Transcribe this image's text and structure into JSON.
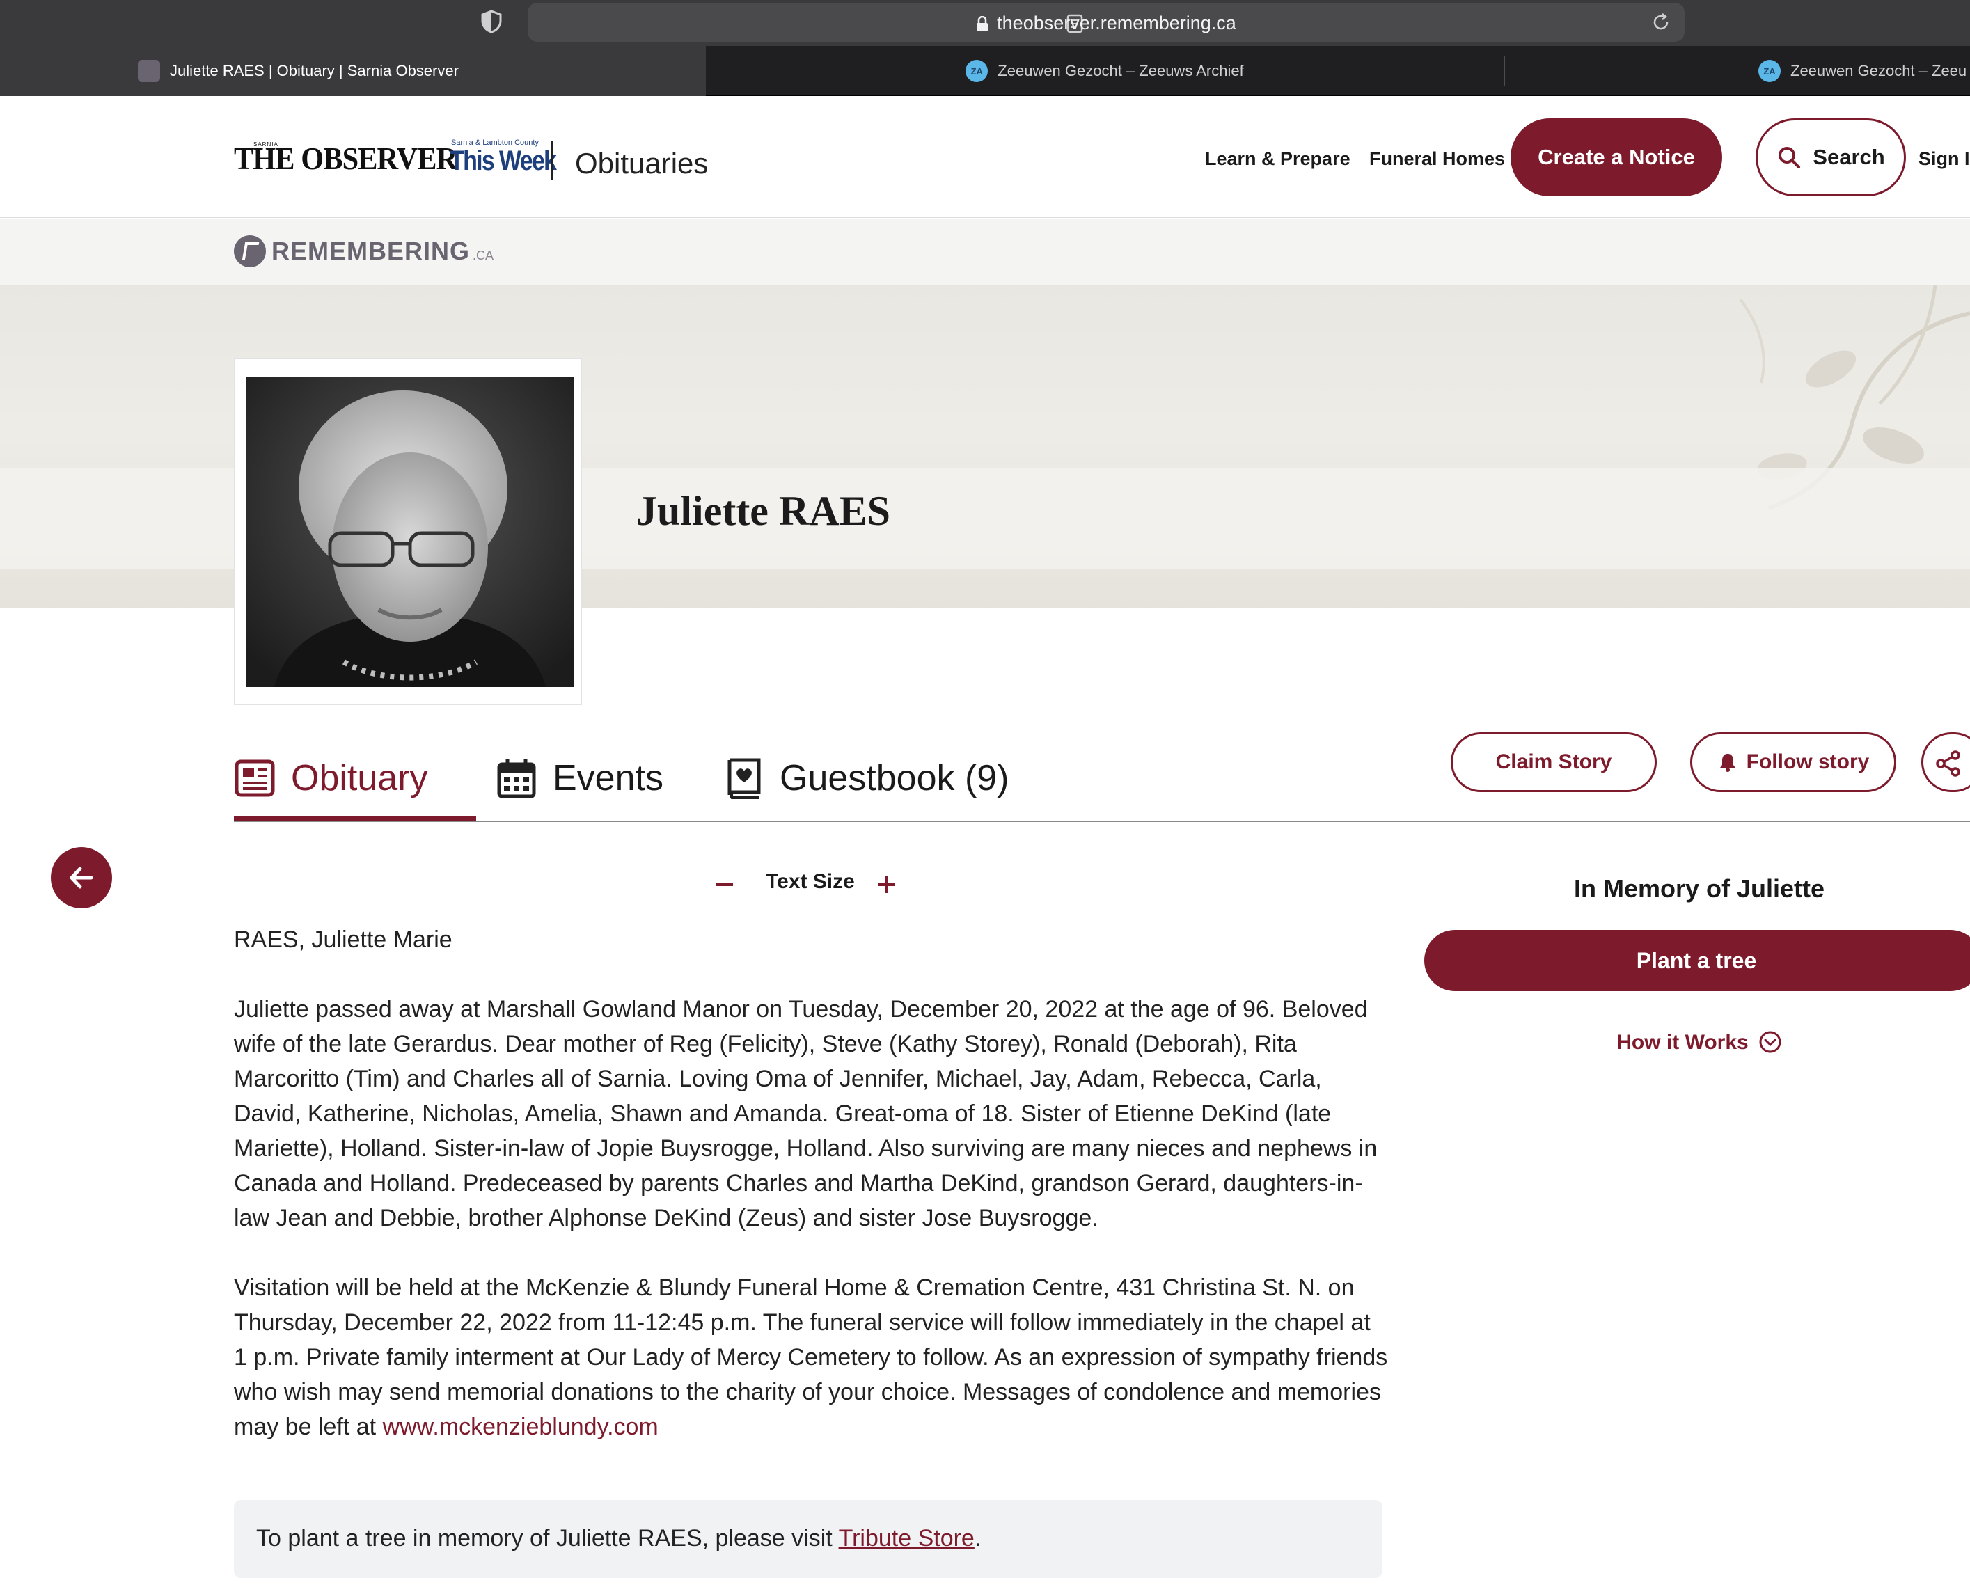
{
  "browser": {
    "url": "theobserver.remembering.ca",
    "tabs": [
      {
        "title": "Juliette RAES | Obituary | Sarnia Observer",
        "active": true
      },
      {
        "title": "Zeeuwen Gezocht – Zeeuws Archief",
        "active": false
      },
      {
        "title": "Zeeuwen Gezocht – Zeeu",
        "active": false
      }
    ]
  },
  "header": {
    "logo_sarnia": "SARNIA",
    "logo_observer": "THE OBSERVER",
    "logo_thisweek_small": "Sarnia & Lambton County",
    "logo_thisweek": "This Week",
    "section": "Obituaries",
    "nav": {
      "learn": "Learn & Prepare",
      "funeral_homes": "Funeral Homes",
      "create": "Create a Notice",
      "search": "Search",
      "sign_in": "Sign In"
    }
  },
  "brand": {
    "remembering": "REMEMBERING",
    "remembering_suffix": ".CA"
  },
  "obituary": {
    "name": "Juliette RAES",
    "tabs": {
      "obituary": "Obituary",
      "events": "Events",
      "guestbook": "Guestbook (9)"
    },
    "actions": {
      "claim": "Claim Story",
      "follow": "Follow story"
    },
    "text_size_label": "Text Size",
    "heading": "RAES, Juliette Marie",
    "paragraph1": "Juliette passed away at Marshall Gowland Manor on Tuesday, December 20, 2022 at the age of 96. Beloved wife of the late Gerardus. Dear mother of Reg (Felicity), Steve (Kathy Storey), Ronald (Deborah), Rita Marcoritto (Tim) and Charles all of Sarnia. Loving Oma of Jennifer, Michael, Jay, Adam, Rebecca, Carla, David, Katherine, Nicholas, Amelia, Shawn and Amanda. Great-oma of 18. Sister of Etienne DeKind (late Mariette), Holland. Sister-in-law of Jopie Buysrogge, Holland. Also surviving are many nieces and nephews in Canada and Holland. Predeceased by parents Charles and Martha DeKind, grandson Gerard, daughters-in-law Jean and Debbie, brother Alphonse DeKind (Zeus) and sister Jose Buysrogge.",
    "paragraph2": "Visitation will be held at the McKenzie & Blundy Funeral Home & Cremation Centre, 431 Christina St. N. on Thursday, December 22, 2022 from 11-12:45 p.m. The funeral service will follow immediately in the chapel at 1 p.m. Private family interment at Our Lady of Mercy Cemetery to follow. As an expression of sympathy friends who wish may send memorial donations to the charity of your choice. Messages of condolence and memories may be left at",
    "link": "www.mckenzieblundy.com",
    "tree_note_prefix": "To plant a tree in memory of Juliette RAES, please visit",
    "tree_note_link": "Tribute Store",
    "tree_note_suffix": "."
  },
  "sidebar": {
    "title": "In Memory of Juliette",
    "plant": "Plant a tree",
    "how": "How it Works"
  },
  "colors": {
    "accent": "#7d1a2c",
    "chrome": "#3a3a3c",
    "tabbar": "#1f1f21"
  }
}
